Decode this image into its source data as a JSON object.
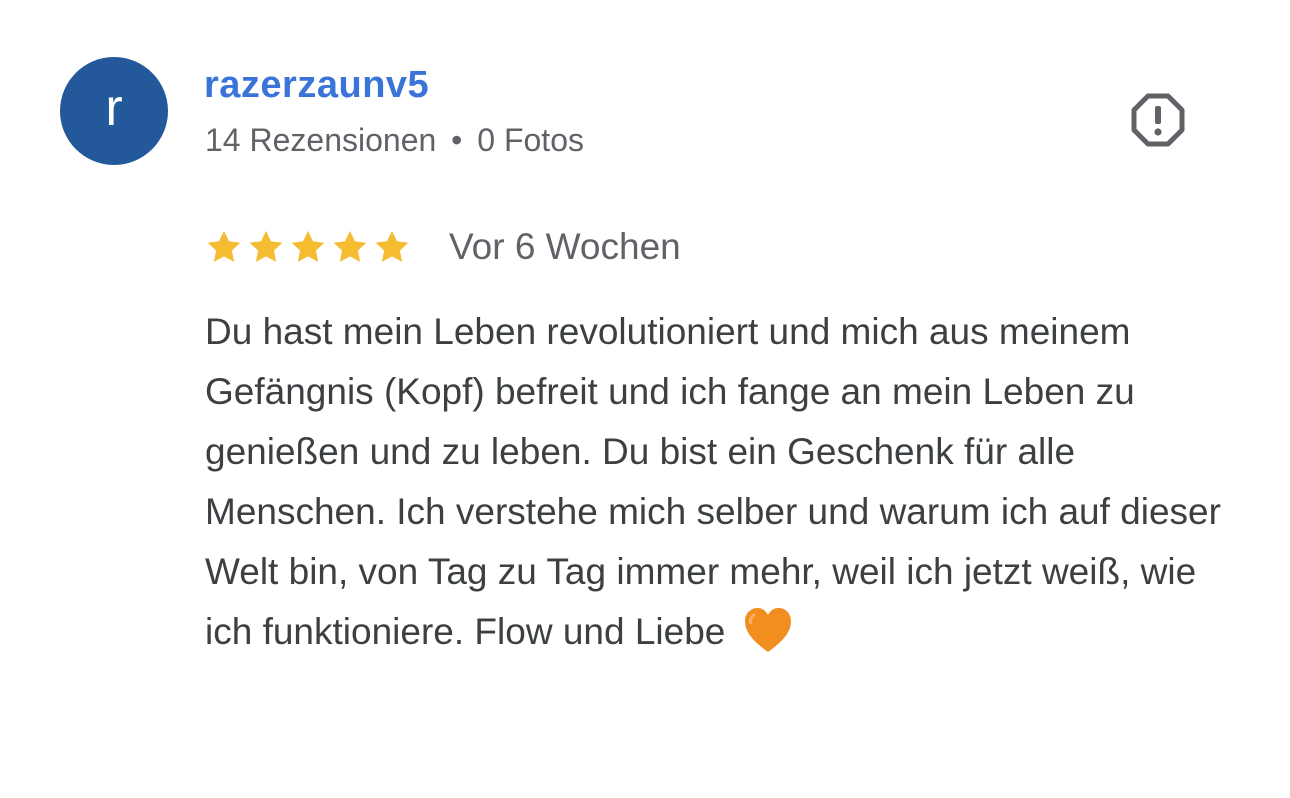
{
  "review": {
    "avatar_letter": "r",
    "avatar_color": "#23589a",
    "author": "razerzaunv5",
    "reviews_count": "14 Rezensionen",
    "separator": "•",
    "photos_count": "0 Fotos",
    "rating": 5,
    "rating_max": 5,
    "time_ago": "Vor 6 Wochen",
    "text": "Du hast mein Leben revolutioniert und mich aus meinem Gefängnis (Kopf) befreit und ich fange an mein Leben zu genießen und zu leben. Du bist ein Geschenk für alle Menschen. Ich verstehe mich selber und warum ich auf dieser Welt bin, von Tag zu Tag immer mehr, weil ich jetzt weiß, wie ich funktioniere. Flow und Liebe",
    "emoji": "orange-heart-icon",
    "icons": {
      "report": "report-flag-icon",
      "star": "star-icon"
    },
    "colors": {
      "author": "#3b74d9",
      "star": "#f5bc31",
      "heart": "#f28d1f",
      "secondary_text": "#5f6368",
      "body_text": "#3c4043"
    }
  }
}
